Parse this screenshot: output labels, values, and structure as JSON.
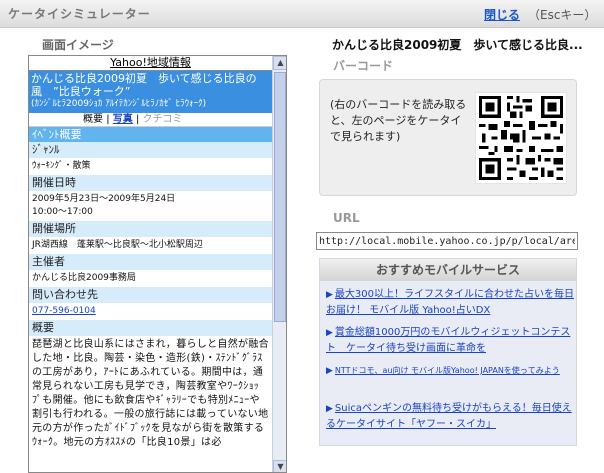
{
  "header": {
    "title": "ケータイシミュレーター",
    "close_label": "閉じる",
    "esc_label": "（Escキー）"
  },
  "preview": {
    "label": "画面イメージ",
    "site_title": "Yahoo!地域情報",
    "page_title": "かんじる比良2009初夏　歩いて感じる比良の風　”比良ウォーク”",
    "page_title_kana": "(ｶﾝｼﾞﾙﾋﾗ2009ｼｮｶ ｱﾙｲﾃｶﾝｼﾞﾙﾋﾗﾉｶｾﾞ ﾋﾗｳｫｰｸ)",
    "tabs": [
      "概要",
      "写真",
      "クチコミ"
    ],
    "section_title": "ｲﾍﾞﾝﾄ概要",
    "fields": [
      {
        "label": "ｼﾞｬﾝﾙ",
        "value": "ｳｫｰｷﾝｸﾞ・散策"
      },
      {
        "label": "開催日時",
        "value": "2009年5月23日～2009年5月24日",
        "value2": "10:00～17:00"
      },
      {
        "label": "開催場所",
        "value": "JR湖西線　蓬莱駅～比良駅～北小松駅周辺"
      },
      {
        "label": "主催者",
        "value": "かんじる比良2009事務局"
      },
      {
        "label": "問い合わせ先",
        "value": "077-596-0104"
      }
    ],
    "summary_label": "概要",
    "summary_text": "琵琶湖と比良山系にはさまれ，暮らしと自然が融合した地・比良。陶芸・染色・造形(鉄)・ｽﾃﾝﾄﾞｸﾞﾗｽの工房があり，ｱｰﾄにあふれている。期間中は，通常見られない工房も見学でき，陶芸教室やﾜｰｸｼｮｯﾌﾟも開催。他にも飲食店やｷﾞｬﾗﾘｰでも特別ﾒﾆｭｰや割引も行われる。一般の旅行誌には載っていない地元の方が作ったｶﾞｲﾄﾞﾌﾞｯｸを見ながら街を散策するｳｫｰｸ。地元の方ｵｽｽﾒの「比良10景」は必"
  },
  "right": {
    "page_title": "かんじる比良2009初夏　歩いて感じる比良...",
    "barcode_label": "バーコード",
    "barcode_text": "(右のバーコードを読み取ると、左のページをケータイで見られます)",
    "url_label": "URL",
    "url_value": "http://local.mobile.yahoo.co.jp/p/local/area/eventdetail",
    "services_title": "おすすめモバイルサービス",
    "services": [
      {
        "line1": "最大300以上！ライフスタイルに合わせた占いを毎日お届け！ モバイル版 Yahoo!占いDX"
      },
      {
        "line1": "賞金総額1000万円のモバイルウィジェットコンテスト　ケータイ待ち受け画面に革命を"
      },
      {
        "line1": "NTTドコモ、au向け モバイル版Yahoo! JAPANを使ってみよう"
      },
      {
        "line1": "Suicaペンギンの無料待ち受けがもらえる！毎日使えるケータイサイト「ヤフー・スイカ」"
      }
    ]
  },
  "colors": {
    "accent_blue": "#3b8fe0",
    "section_blue": "#62b4ee",
    "header_light": "#d6ecfb",
    "link": "#1a44c8"
  },
  "icons": [
    "qr-code-icon",
    "arrow-right-icon",
    "scroll-up-icon",
    "scroll-down-icon"
  ]
}
